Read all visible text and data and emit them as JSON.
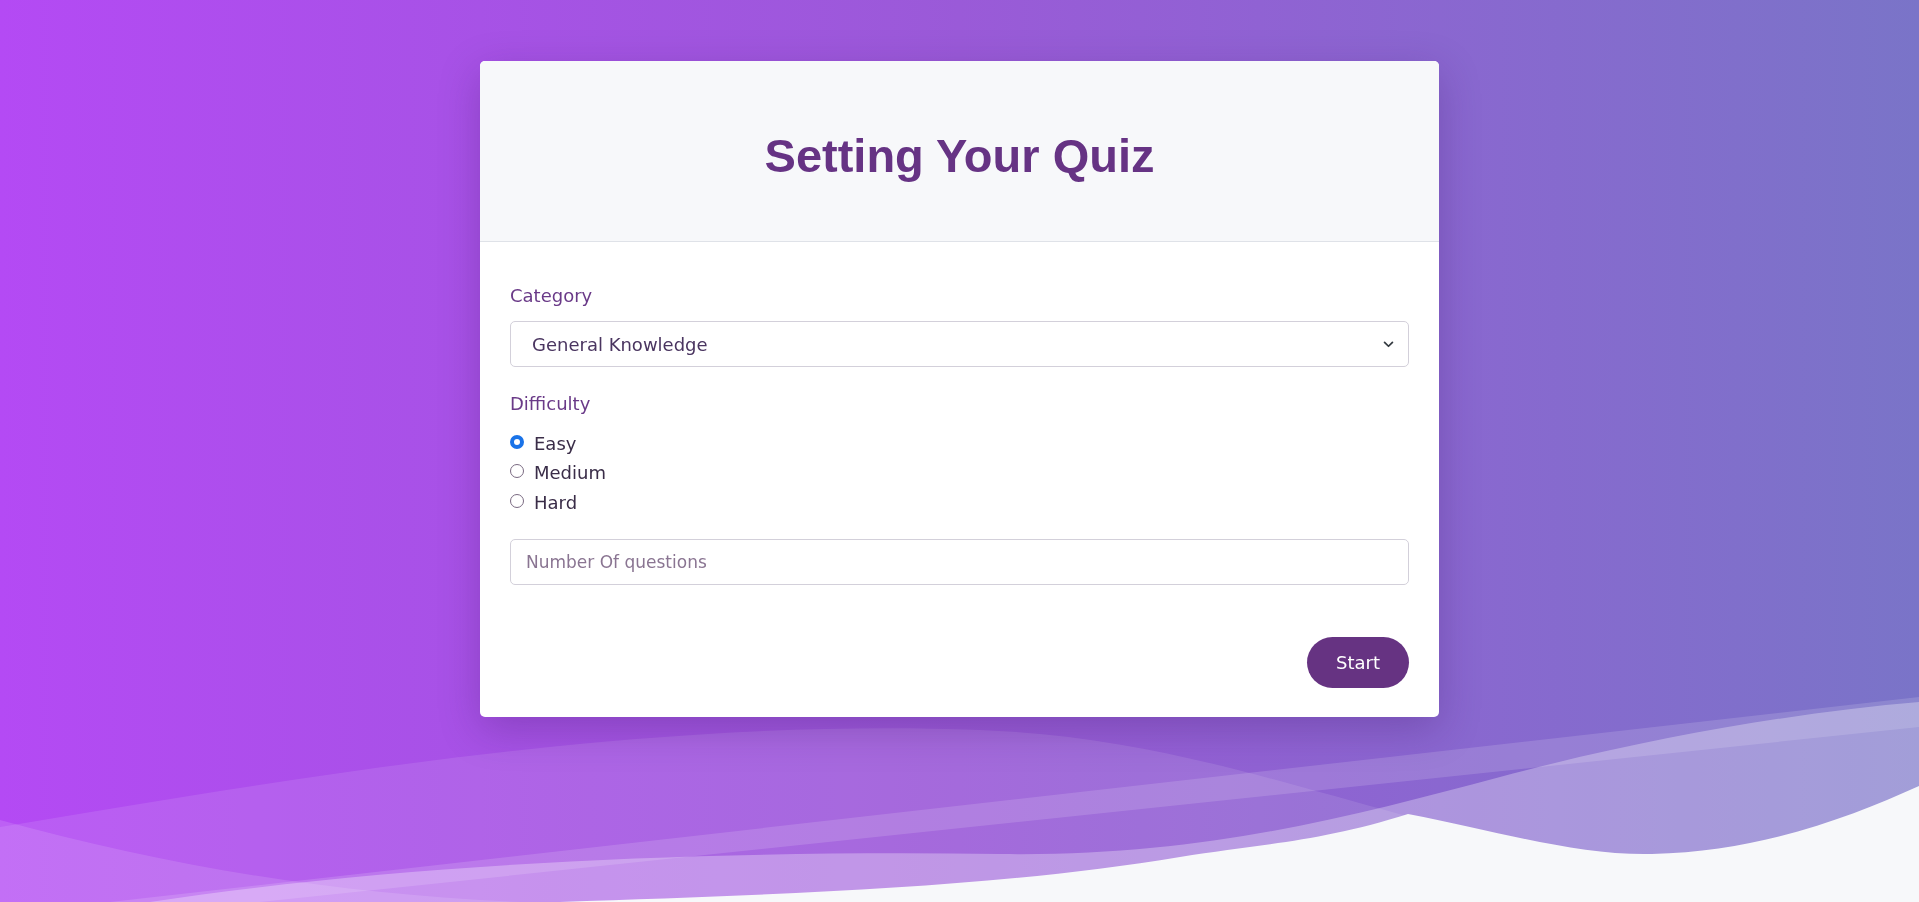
{
  "card": {
    "title": "Setting Your Quiz"
  },
  "form": {
    "category": {
      "label": "Category",
      "value": "General Knowledge"
    },
    "difficulty": {
      "label": "Difficulty",
      "options": [
        {
          "label": "Easy",
          "selected": true
        },
        {
          "label": "Medium",
          "selected": false
        },
        {
          "label": "Hard",
          "selected": false
        }
      ]
    },
    "questions": {
      "placeholder": "Number Of questions"
    },
    "submit": {
      "label": "Start"
    }
  }
}
